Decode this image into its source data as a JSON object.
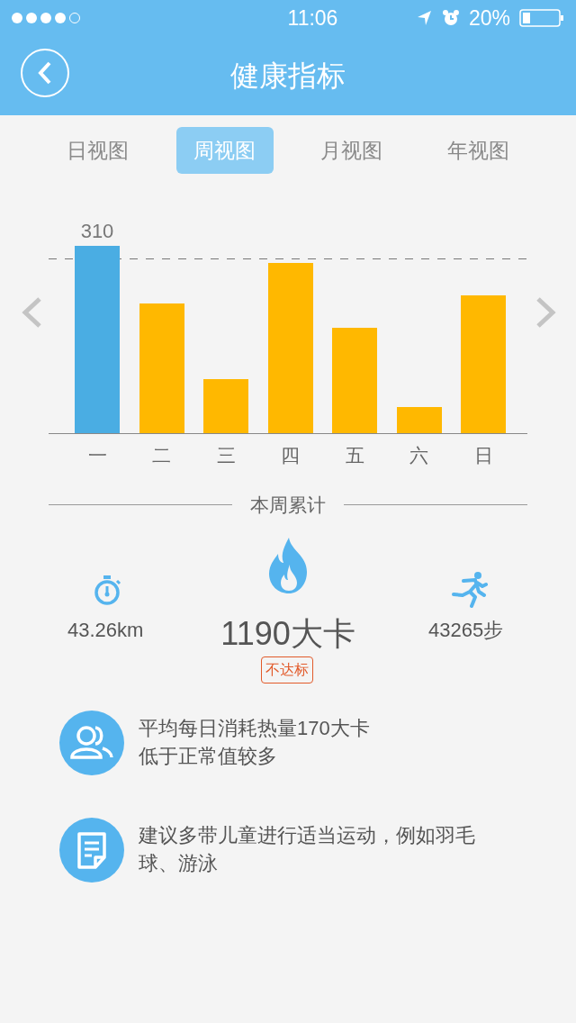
{
  "status_bar": {
    "time": "11:06",
    "battery": "20%",
    "signal_dots": [
      {
        "on": true
      },
      {
        "on": true
      },
      {
        "on": true
      },
      {
        "on": true
      },
      {
        "on": false
      }
    ]
  },
  "nav": {
    "title": "健康指标"
  },
  "tabs": [
    {
      "label": "日视图",
      "selected": false
    },
    {
      "label": "周视图",
      "selected": true
    },
    {
      "label": "月视图",
      "selected": false
    },
    {
      "label": "年视图",
      "selected": false
    }
  ],
  "chart": {
    "days": [
      {
        "label": "一",
        "selected": true,
        "value_label": "310"
      },
      {
        "label": "二",
        "selected": false
      },
      {
        "label": "三",
        "selected": false
      },
      {
        "label": "四",
        "selected": false
      },
      {
        "label": "五",
        "selected": false
      },
      {
        "label": "六",
        "selected": false
      },
      {
        "label": "日",
        "selected": false
      }
    ]
  },
  "summary": {
    "heading": "本周累计",
    "distance": "43.26km",
    "calories": "1190大卡",
    "badge": "不达标",
    "steps": "43265步"
  },
  "tips": [
    {
      "kind": "people",
      "lines": [
        "平均每日消耗热量170大卡",
        "低于正常值较多"
      ]
    },
    {
      "kind": "note",
      "lines": [
        "建议多带儿童进行适当运动，例如羽毛球、游泳"
      ]
    }
  ]
}
